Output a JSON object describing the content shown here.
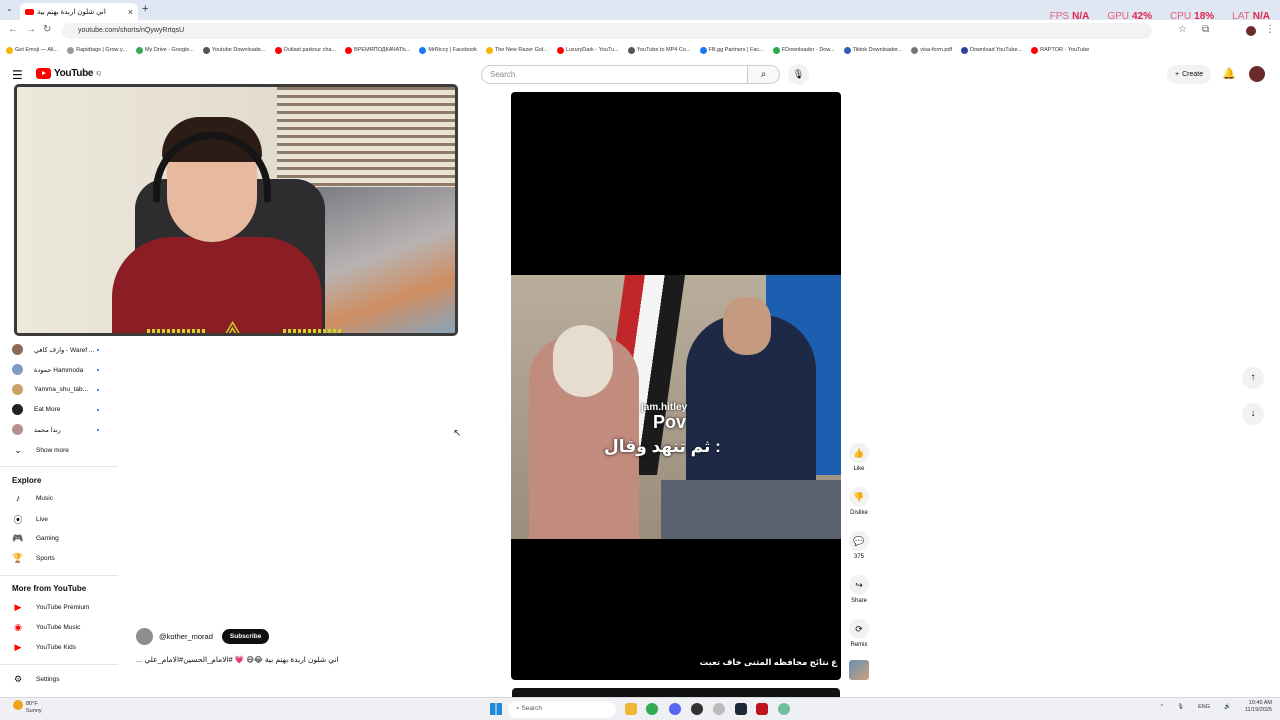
{
  "browser": {
    "tab_title": "اني شلون اربدة بهتم بية",
    "url": "youtube.com/shorts/nQywyRrtqsU",
    "bookmarks": [
      "Get Emoji — All...",
      "Rapidtags | Grow y...",
      "My Drive - Google...",
      "Youtube Downloade...",
      "Outlast parkour cha...",
      "ВРЕМЯПОДКАЧАТЬ...",
      "MrRiccy | Facebook",
      "The New Razer Gol...",
      "LuxuryDark - YouTu...",
      "YouTube to MP4 Co...",
      "FB.gg Partners | Fac...",
      "FDownloader - Dow...",
      "Tiktok Downloader...",
      "visa-form.pdf",
      "Download YouTube...",
      "RAPTOR - YouTube"
    ]
  },
  "perf": {
    "fps_label": "FPS",
    "fps_value": "N/A",
    "gpu_label": "GPU",
    "gpu_value": "42%",
    "cpu_label": "CPU",
    "cpu_value": "18%",
    "lat_label": "LAT",
    "lat_value": "N/A"
  },
  "header": {
    "logo_text": "YouTube",
    "logo_region": "IQ",
    "search_placeholder": "Search",
    "create_label": "Create"
  },
  "sidebar": {
    "subscriptions": [
      {
        "name": "وارف كافي - Waref ...",
        "color": "#8c6b55"
      },
      {
        "name": "حمودة Hammoda",
        "color": "#7e9bc2"
      },
      {
        "name": "Yamma_shu_tab...",
        "color": "#c9a06a"
      },
      {
        "name": "Eat More",
        "color": "#222222"
      },
      {
        "name": "رندا محمد",
        "color": "#b88f8f"
      }
    ],
    "show_more": "Show more",
    "explore_heading": "Explore",
    "explore": [
      "Music",
      "Live",
      "Gaming",
      "Sports"
    ],
    "more_heading": "More from YouTube",
    "more": [
      "YouTube Premium",
      "YouTube Music",
      "YouTube Kids"
    ],
    "settings": "Settings"
  },
  "short": {
    "overlay_user": "jam.hitley",
    "overlay_pov": "Pov",
    "overlay_text": "ثم تنهد وقال :",
    "caption": "ع نتائج محافظه المثنى خاف تعبت",
    "channel": "@kother_morad",
    "subscribe_label": "Subscribe",
    "title": "... اني شلون اربدة بهتم بية 😂😅 💗 #الامام_الحسين#الامام_علي"
  },
  "actions": {
    "like": "Like",
    "dislike": "Dislike",
    "comments": "375",
    "share": "Share",
    "remix": "Remix"
  },
  "taskbar": {
    "weather_temp": "80°F",
    "weather_desc": "Sunny",
    "search_placeholder": "Search",
    "lang": "ENG",
    "time": "10:40 AM",
    "date": "11/19/2025"
  }
}
